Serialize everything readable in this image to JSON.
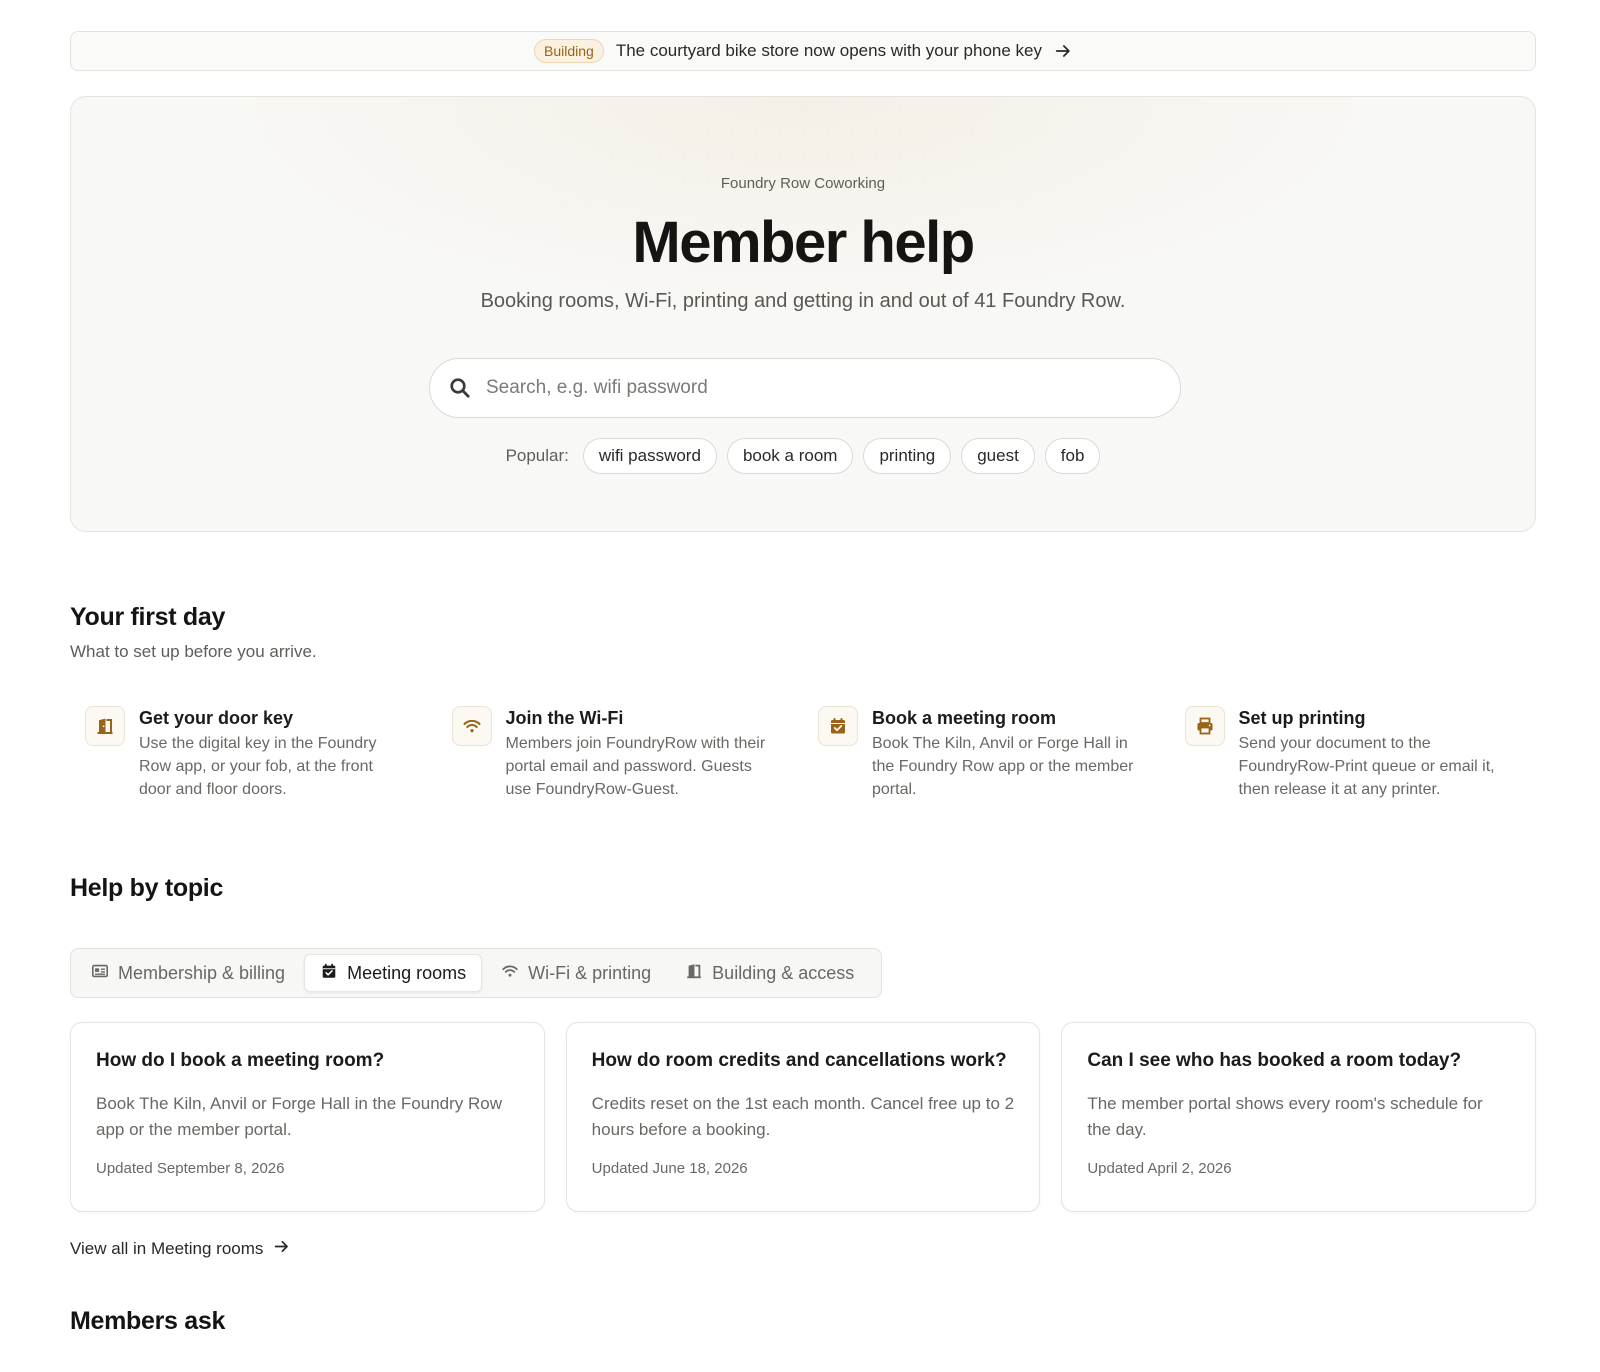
{
  "announcement": {
    "badge": "Building",
    "text": "The courtyard bike store now opens with your phone key"
  },
  "hero": {
    "eyebrow": "Foundry Row Coworking",
    "title": "Member help",
    "subtitle": "Booking rooms, Wi-Fi, printing and getting in and out of 41 Foundry Row.",
    "search_placeholder": "Search, e.g. wifi password",
    "search_value": "",
    "popular_label": "Popular:",
    "popular": [
      "wifi password",
      "book a room",
      "printing",
      "guest",
      "fob"
    ]
  },
  "first_day": {
    "title": "Your first day",
    "subtitle": "What to set up before you arrive.",
    "items": [
      {
        "icon": "door-icon",
        "title": "Get your door key",
        "text": "Use the digital key in the Foundry Row app, or your fob, at the front door and floor doors."
      },
      {
        "icon": "wifi-icon",
        "title": "Join the Wi-Fi",
        "text": "Members join FoundryRow with their portal email and password. Guests use FoundryRow-Guest."
      },
      {
        "icon": "calendar-check-icon",
        "title": "Book a meeting room",
        "text": "Book The Kiln, Anvil or Forge Hall in the Foundry Row app or the member portal."
      },
      {
        "icon": "printer-icon",
        "title": "Set up printing",
        "text": "Send your document to the FoundryRow-Print queue or email it, then release it at any printer."
      }
    ]
  },
  "topics": {
    "title": "Help by topic",
    "tabs": [
      {
        "icon": "id-card-icon",
        "label": "Membership & billing",
        "active": false
      },
      {
        "icon": "calendar-check-icon",
        "label": "Meeting rooms",
        "active": true
      },
      {
        "icon": "wifi-icon",
        "label": "Wi-Fi & printing",
        "active": false
      },
      {
        "icon": "door-icon",
        "label": "Building & access",
        "active": false
      }
    ],
    "articles": [
      {
        "title": "How do I book a meeting room?",
        "text": "Book The Kiln, Anvil or Forge Hall in the Foundry Row app or the member portal.",
        "updated": "Updated September 8, 2026"
      },
      {
        "title": "How do room credits and cancellations work?",
        "text": "Credits reset on the 1st each month. Cancel free up to 2 hours before a booking.",
        "updated": "Updated June 18, 2026"
      },
      {
        "title": "Can I see who has booked a room today?",
        "text": "The member portal shows every room's schedule for the day.",
        "updated": "Updated April 2, 2026"
      }
    ],
    "view_all": "View all in Meeting rooms"
  },
  "members_ask": {
    "title": "Members ask"
  },
  "colors": {
    "accent": "#9a6418",
    "accent_bg": "#fbf1e1",
    "text": "#1c1b19",
    "muted": "#6a6863",
    "border": "#e4e2dd"
  }
}
